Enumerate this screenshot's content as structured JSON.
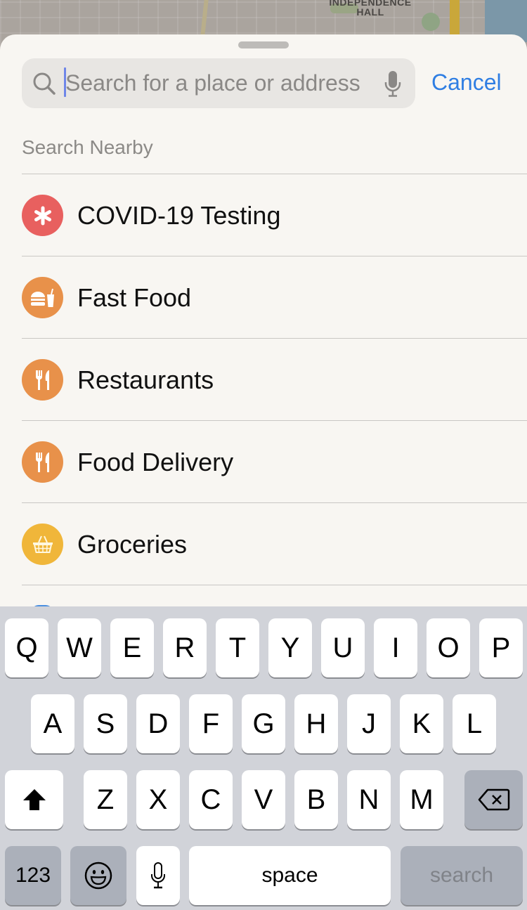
{
  "map": {
    "landmark_label_line1": "INDEPENDENCE",
    "landmark_label_line2": "HALL"
  },
  "search": {
    "placeholder": "Search for a place or address",
    "value": "",
    "cancel_label": "Cancel"
  },
  "section_header": "Search Nearby",
  "nearby_items": [
    {
      "label": "COVID-19 Testing",
      "icon": "asterisk-medical-icon",
      "color": "#e8605f"
    },
    {
      "label": "Fast Food",
      "icon": "burger-drink-icon",
      "color": "#e8914a"
    },
    {
      "label": "Restaurants",
      "icon": "fork-knife-icon",
      "color": "#e8914a"
    },
    {
      "label": "Food Delivery",
      "icon": "fork-knife-icon",
      "color": "#e8914a"
    },
    {
      "label": "Groceries",
      "icon": "basket-icon",
      "color": "#f0b63a"
    }
  ],
  "keyboard": {
    "row1": [
      "Q",
      "W",
      "E",
      "R",
      "T",
      "Y",
      "U",
      "I",
      "O",
      "P"
    ],
    "row2": [
      "A",
      "S",
      "D",
      "F",
      "G",
      "H",
      "J",
      "K",
      "L"
    ],
    "row3": [
      "Z",
      "X",
      "C",
      "V",
      "B",
      "N",
      "M"
    ],
    "numbers_label": "123",
    "space_label": "space",
    "search_label": "search"
  },
  "colors": {
    "accent": "#2f7ee3",
    "sheet_bg": "#f8f6f2",
    "keyboard_bg": "#d1d3d9"
  }
}
